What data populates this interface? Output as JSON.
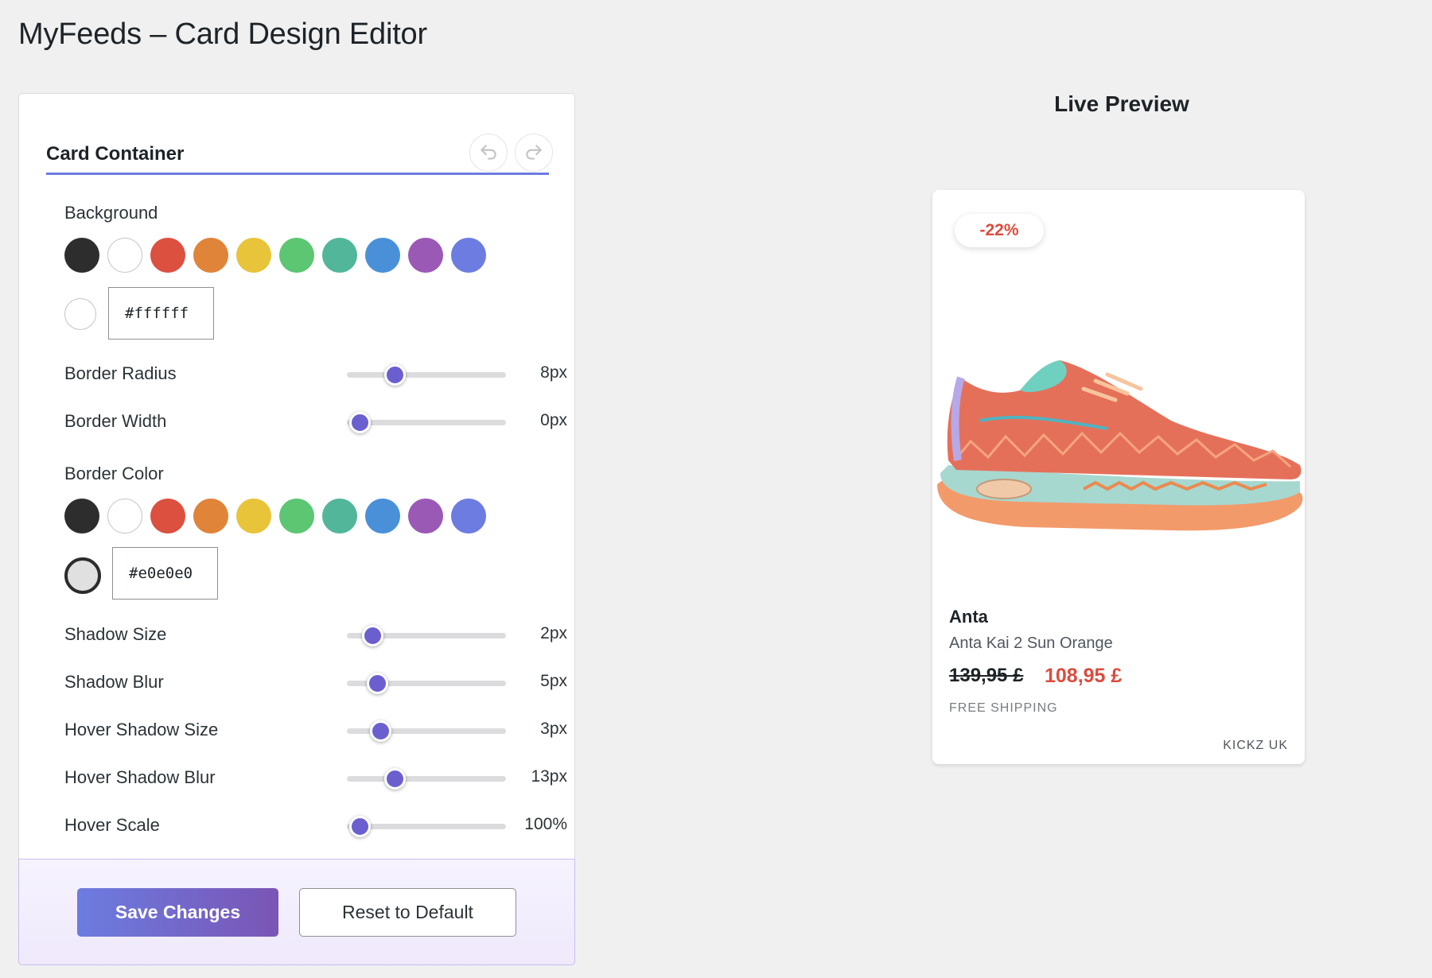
{
  "page": {
    "title": "MyFeeds – Card Design Editor"
  },
  "editor": {
    "section_title": "Card Container",
    "undo_icon": "undo-icon",
    "redo_icon": "redo-icon",
    "background": {
      "label": "Background",
      "swatches": [
        "#2d2d2d",
        "#ffffff",
        "#dc5040",
        "#e0843a",
        "#e8c43a",
        "#5cc673",
        "#52b79a",
        "#4a90d9",
        "#9b59b6",
        "#6c7ce0"
      ],
      "current_color": "#ffffff",
      "hex_value": "#ffffff"
    },
    "border_radius": {
      "label": "Border Radius",
      "value": "8px",
      "level": 0.3
    },
    "border_width": {
      "label": "Border Width",
      "value": "0px",
      "level": 0.08
    },
    "border_color": {
      "label": "Border Color",
      "swatches": [
        "#2d2d2d",
        "#ffffff",
        "#dc5040",
        "#e0843a",
        "#e8c43a",
        "#5cc673",
        "#52b79a",
        "#4a90d9",
        "#9b59b6",
        "#6c7ce0"
      ],
      "current_color": "#e0e0e0",
      "hex_value": "#e0e0e0"
    },
    "shadow_size": {
      "label": "Shadow Size",
      "value": "2px",
      "level": 0.16
    },
    "shadow_blur": {
      "label": "Shadow Blur",
      "value": "5px",
      "level": 0.19
    },
    "hover_shadow_size": {
      "label": "Hover Shadow Size",
      "value": "3px",
      "level": 0.21
    },
    "hover_shadow_blur": {
      "label": "Hover Shadow Blur",
      "value": "13px",
      "level": 0.3
    },
    "hover_scale": {
      "label": "Hover Scale",
      "value": "100%",
      "level": 0.08
    },
    "save_label": "Save Changes",
    "reset_label": "Reset to Default",
    "accent_color": "#6c7ce0"
  },
  "preview": {
    "title": "Live Preview",
    "card": {
      "badge": "-22%",
      "brand": "Anta",
      "product_name": "Anta Kai 2 Sun Orange",
      "price_old": "139,95 £",
      "price_new": "108,95 £",
      "shipping": "FREE SHIPPING",
      "merchant": "KICKZ UK",
      "image_icon": "sneaker-image"
    }
  }
}
